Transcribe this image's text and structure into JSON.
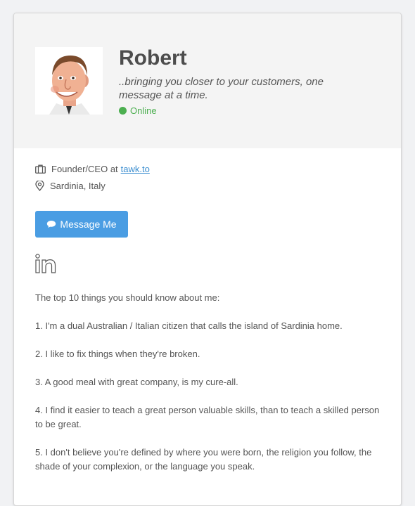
{
  "profile": {
    "name": "Robert",
    "tagline": "..bringing you closer to your customers, one message at a time.",
    "status": "Online",
    "job_prefix": "Founder/CEO at",
    "company": "tawk.to",
    "location": "Sardinia, Italy",
    "message_button": "Message Me"
  },
  "icons": {
    "job": "briefcase-icon",
    "location": "map-pin-icon",
    "message": "chat-bubble-icon",
    "social": "linkedin-icon"
  },
  "colors": {
    "accent": "#4a9de3",
    "online": "#4caf50",
    "link": "#3d8fd0"
  },
  "about": {
    "intro": "The top 10 things you should know about me:",
    "items": [
      "1. I'm a dual Australian / Italian citizen that calls the island of Sardinia home.",
      "2. I like to fix things when they're broken.",
      "3. A good meal with great company, is my cure-all.",
      "4. I find it easier to teach a great person valuable skills, than to teach a skilled person to be great.",
      "5. I don't believe you're defined by where you were born, the religion you follow, the shade of your complexion, or the language you speak."
    ]
  }
}
